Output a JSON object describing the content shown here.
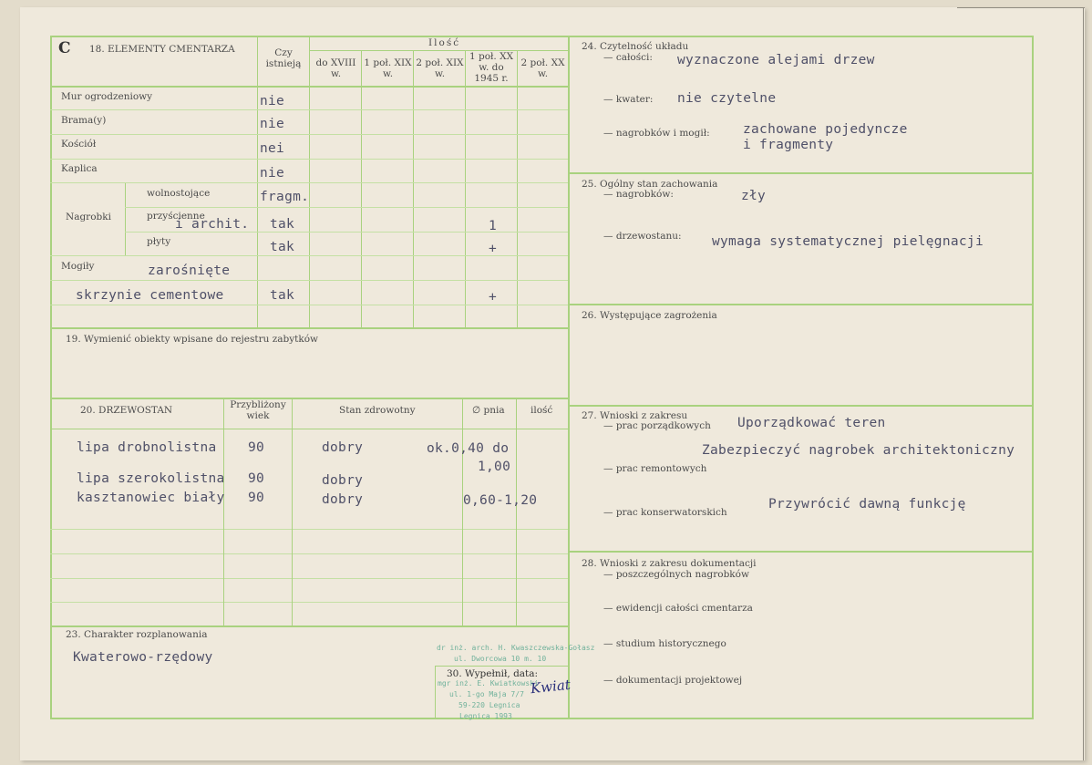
{
  "section_letter": "C",
  "s18": {
    "title": "18. ELEMENTY CMENTARZA",
    "col_exists": "Czy istnieją",
    "col_qty": "Ilość",
    "periods": [
      "do XVIII w.",
      "1 poł. XIX w.",
      "2 poł. XIX w.",
      "1 poł. XX w. do 1945 r.",
      "2 poł. XX w."
    ],
    "rows": {
      "mur": {
        "label": "Mur ogrodzeniowy",
        "exists": "nie"
      },
      "brama": {
        "label": "Brama(y)",
        "exists": "nie"
      },
      "kosciol": {
        "label": "Kościół",
        "exists": "nei"
      },
      "kaplica": {
        "label": "Kaplica",
        "exists": "nie"
      },
      "nagrobki_label": "Nagrobki",
      "wolno": {
        "label": "wolnostojące",
        "exists": "fragm."
      },
      "przysc": {
        "label": "przyścienne",
        "typed": "i archit.",
        "exists": "tak",
        "qty": "1"
      },
      "plyty": {
        "label": "płyty",
        "exists": "tak",
        "qty": "+"
      },
      "mogily": {
        "label": "Mogiły",
        "typed": "zarośnięte"
      },
      "skrzynie": {
        "typed": "skrzynie cementowe",
        "exists": "tak",
        "qty": "+"
      }
    }
  },
  "s19": {
    "title": "19. Wymienić obiekty wpisane do rejestru zabytków"
  },
  "s20": {
    "title": "20. DRZEWOSTAN",
    "col_age": "Przybliżony wiek",
    "col_health": "Stan zdrowotny",
    "col_diam": "∅ pnia",
    "col_count": "ilość",
    "rows": [
      {
        "name": "lipa drobnolistna",
        "age": "90",
        "health": "dobry",
        "diam": "ok.0,40 do"
      },
      {
        "name": "",
        "age": "",
        "health": "",
        "diam": "1,00"
      },
      {
        "name": "lipa szerokolistna",
        "age": "90",
        "health": "dobry",
        "diam": ""
      },
      {
        "name": "kasztanowiec biały",
        "age": "90",
        "health": "dobry",
        "diam": "0,60-1,20"
      }
    ]
  },
  "s23": {
    "title": "23. Charakter rozplanowania",
    "value": "Kwaterowo-rzędowy"
  },
  "s30": {
    "title": "30. Wypełnił, data:",
    "stamp_lines": [
      "dr inż. arch. H. Kwaszczewska-Gołasz",
      "ul. Dworcowa 10 m. 10",
      "mgr inż. E. Kwiatkowski",
      "ul. 1-go Maja 7/7",
      "59-220 Legnica",
      "Legnica 1993"
    ],
    "signature": "Kwiat"
  },
  "s24": {
    "title": "24. Czytelność układu",
    "calosci_label": "— całości:",
    "calosci_value": "wyznaczone alejami drzew",
    "kwater_label": "— kwater:",
    "kwater_value": "nie czytelne",
    "nagrobkow_label": "— nagrobków i mogił:",
    "nagrobkow_value1": "zachowane pojedyncze",
    "nagrobkow_value2": "i fragmenty"
  },
  "s25": {
    "title": "25. Ogólny stan zachowania",
    "nagrobkow_label": "— nagrobków:",
    "nagrobkow_value": "zły",
    "drzew_label": "— drzewostanu:",
    "drzew_value": "wymaga systematycznej pielęgnacji"
  },
  "s26": {
    "title": "26. Występujące zagrożenia"
  },
  "s27": {
    "title": "27. Wnioski z zakresu",
    "porz_label": "— prac porządkowych",
    "porz_value": "Uporządkować teren",
    "porz_value2": "Zabezpieczyć nagrobek architektoniczny",
    "rem_label": "— prac remontowych",
    "kons_label": "— prac konserwatorskich",
    "kons_value": "Przywrócić dawną funkcję"
  },
  "s28": {
    "title": "28. Wnioski z zakresu dokumentacji",
    "items": [
      "— poszczególnych nagrobków",
      "— ewidencji całości cmentarza",
      "— studium historycznego",
      "— dokumentacji projektowej"
    ]
  }
}
